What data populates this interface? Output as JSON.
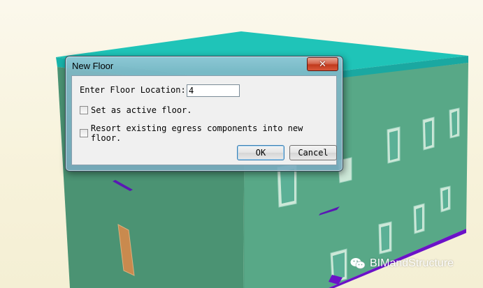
{
  "dialog": {
    "title": "New Floor",
    "location_label": "Enter Floor Location:",
    "location_value": "4",
    "checkbox_active": "Set as active floor.",
    "checkbox_resort": "Resort existing egress components into new floor.",
    "ok_label": "OK",
    "cancel_label": "Cancel",
    "close_glyph": "✕"
  },
  "watermark": {
    "text": "BIMandStructure",
    "icon": "wechat-icon"
  },
  "colors": {
    "wall_green": "#4e9e7c",
    "roof_cyan": "#19c9c0",
    "window_frame": "#cfeee0",
    "door": "#c98a4e",
    "close_red": "#c94a2f"
  }
}
